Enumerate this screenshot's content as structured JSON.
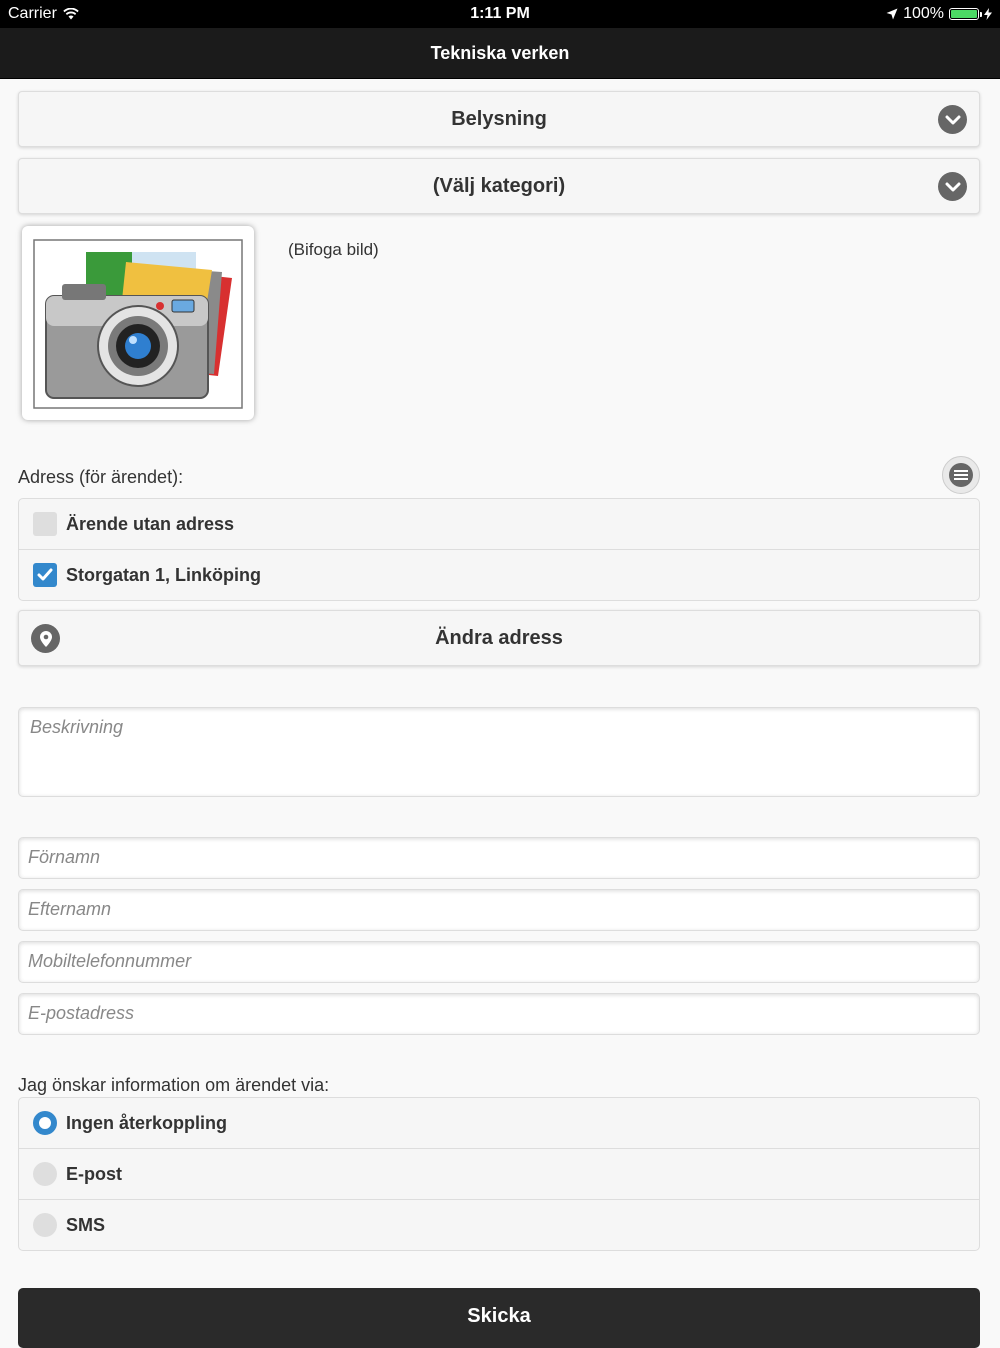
{
  "status_bar": {
    "carrier": "Carrier",
    "time": "1:11 PM",
    "battery": "100%"
  },
  "header": {
    "title": "Tekniska verken"
  },
  "selects": {
    "area": "Belysning",
    "category": "(Välj kategori)"
  },
  "attachment": {
    "label": "(Bifoga bild)",
    "icon": "camera-photo-icon"
  },
  "address": {
    "label": "Adress (för ärendet):",
    "options": [
      {
        "label": "Ärende utan adress",
        "checked": false
      },
      {
        "label": "Storgatan 1, Linköping",
        "checked": true
      }
    ],
    "change_button": "Ändra adress"
  },
  "form": {
    "description_placeholder": "Beskrivning",
    "first_name_placeholder": "Förnamn",
    "last_name_placeholder": "Efternamn",
    "phone_placeholder": "Mobiltelefonnummer",
    "email_placeholder": "E-postadress"
  },
  "feedback": {
    "label": "Jag önskar information om ärendet via:",
    "options": [
      {
        "label": "Ingen återkoppling",
        "selected": true
      },
      {
        "label": "E-post",
        "selected": false
      },
      {
        "label": "SMS",
        "selected": false
      }
    ]
  },
  "submit_label": "Skicka",
  "colors": {
    "accent": "#3388cc",
    "header_bg": "#1b1b1b",
    "battery": "#4cd964"
  }
}
